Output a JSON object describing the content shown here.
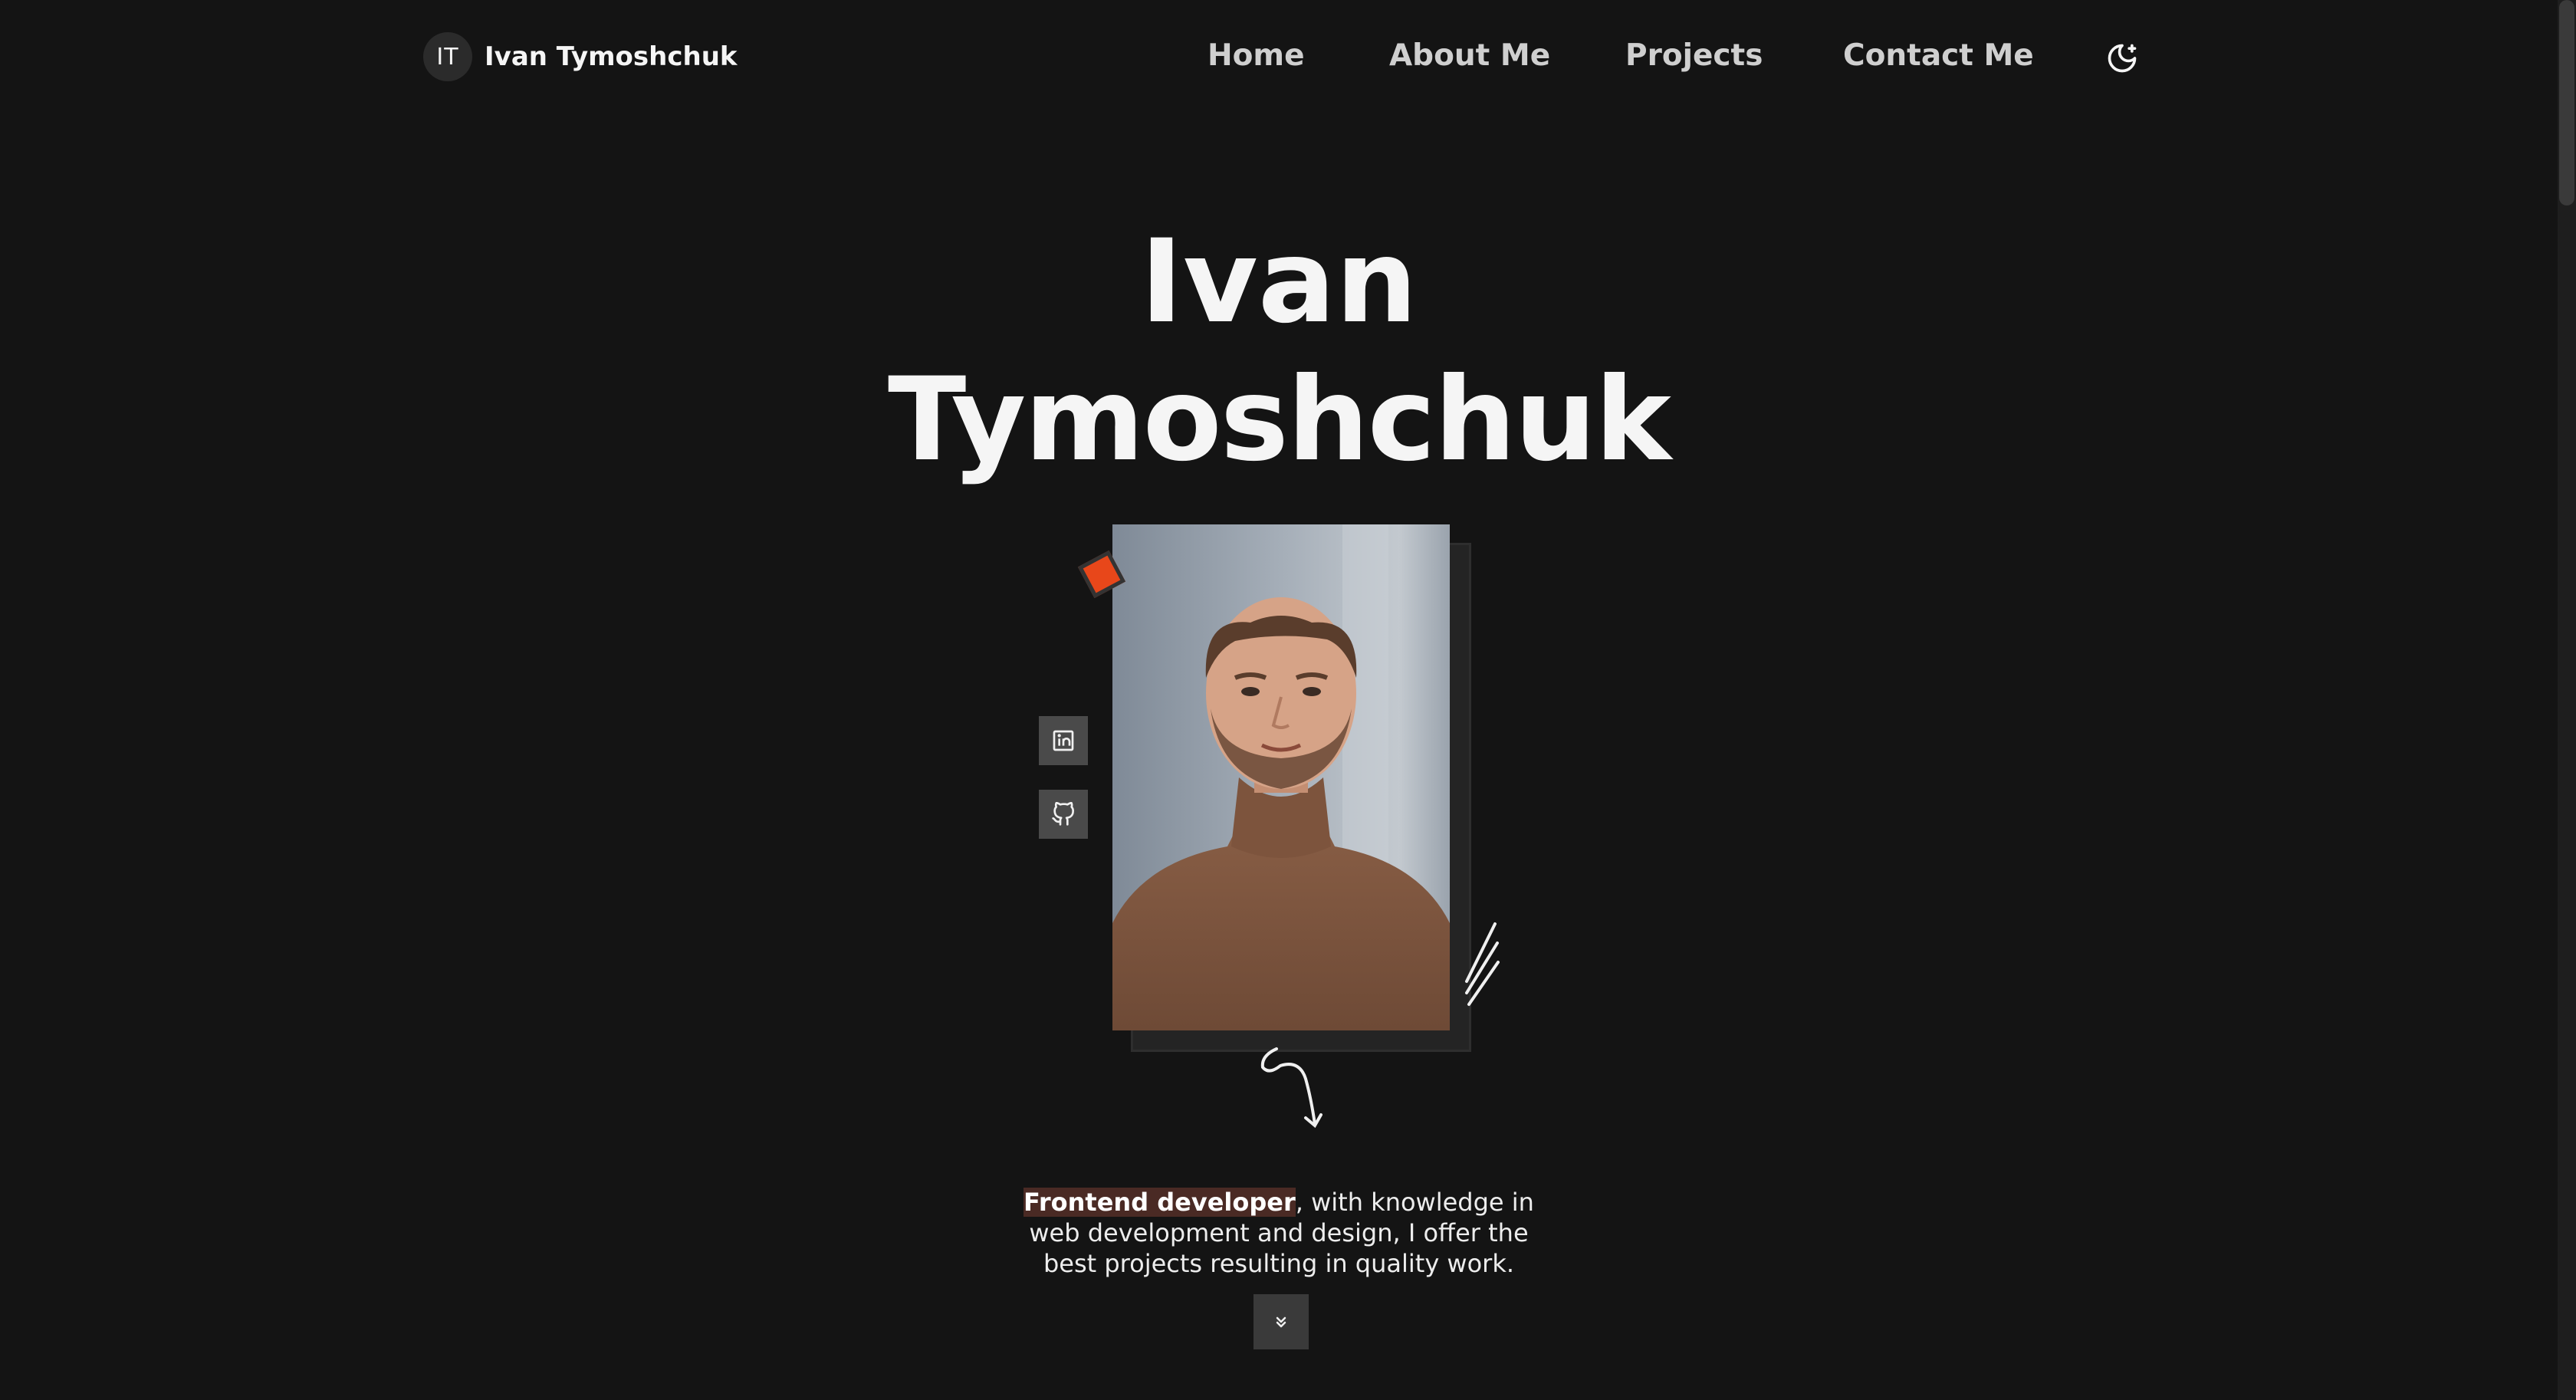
{
  "header": {
    "logo_initials": "IT",
    "logo_name": "Ivan Tymoshchuk",
    "nav": {
      "home": "Home",
      "about": "About Me",
      "projects": "Projects",
      "contact": "Contact Me"
    },
    "theme_toggle_icon": "moon-icon"
  },
  "hero": {
    "title_line1": "Ivan",
    "title_line2": "Tymoshchuk",
    "photo_icon": "portrait-photo",
    "socials": [
      {
        "name": "linkedin",
        "icon": "linkedin-icon"
      },
      {
        "name": "github",
        "icon": "github-icon"
      }
    ],
    "description_highlight": "Frontend developer",
    "description_rest": ", with knowledge in web development and design, I offer the best projects resulting in quality work.",
    "scroll_icon": "chevrons-down-icon"
  },
  "colors": {
    "background": "#141414",
    "accent": "#e8471a",
    "highlight_bg": "#4a2a24"
  }
}
